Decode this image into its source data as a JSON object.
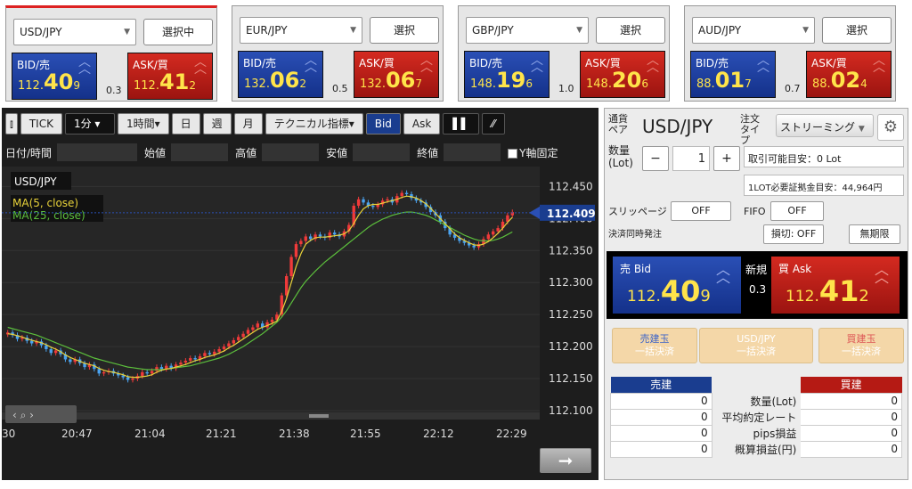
{
  "tiles": [
    {
      "pair": "USD/JPY",
      "button": "選択中",
      "bid_label": "BID/売",
      "ask_label": "ASK/買",
      "bid": {
        "sm": "112.",
        "big": "40",
        "pip": "9"
      },
      "ask": {
        "sm": "112.",
        "big": "41",
        "pip": "2"
      },
      "spread": "0.3"
    },
    {
      "pair": "EUR/JPY",
      "button": "選択",
      "bid_label": "BID/売",
      "ask_label": "ASK/買",
      "bid": {
        "sm": "132.",
        "big": "06",
        "pip": "2"
      },
      "ask": {
        "sm": "132.",
        "big": "06",
        "pip": "7"
      },
      "spread": "0.5"
    },
    {
      "pair": "GBP/JPY",
      "button": "選択",
      "bid_label": "BID/売",
      "ask_label": "ASK/買",
      "bid": {
        "sm": "148.",
        "big": "19",
        "pip": "6"
      },
      "ask": {
        "sm": "148.",
        "big": "20",
        "pip": "6"
      },
      "spread": "1.0"
    },
    {
      "pair": "AUD/JPY",
      "button": "選択",
      "bid_label": "BID/売",
      "ask_label": "ASK/買",
      "bid": {
        "sm": "88.",
        "big": "01",
        "pip": "7"
      },
      "ask": {
        "sm": "88.",
        "big": "02",
        "pip": "4"
      },
      "spread": "0.7"
    }
  ],
  "toolbar": {
    "tick": "TICK",
    "interval": "1分",
    "period": "1時間",
    "day": "日",
    "week": "週",
    "month": "月",
    "indicators": "テクニカル指標",
    "bid": "Bid",
    "ask": "Ask"
  },
  "fields": {
    "datetime": "日付/時間",
    "open": "始値",
    "high": "高値",
    "low": "安値",
    "close": "終値",
    "y_fixed": "Y軸固定"
  },
  "chart_data": {
    "type": "candlestick",
    "symbol": "USD/JPY",
    "legend": [
      "MA(5, close)",
      "MA(25, close)"
    ],
    "ylim": [
      112.1,
      112.47
    ],
    "yticks": [
      "112.450",
      "112.400",
      "112.350",
      "112.300",
      "112.250",
      "112.200",
      "112.150",
      "112.100"
    ],
    "xticks": [
      "30",
      "20:47",
      "21:04",
      "21:21",
      "21:38",
      "21:55",
      "22:12",
      "22:29"
    ],
    "current_price": "112.409",
    "close": [
      112.222,
      112.218,
      112.212,
      112.214,
      112.209,
      112.205,
      112.208,
      112.202,
      112.196,
      112.19,
      112.194,
      112.188,
      112.18,
      112.176,
      112.18,
      112.174,
      112.168,
      112.172,
      112.165,
      112.158,
      112.16,
      112.162,
      112.158,
      112.155,
      112.152,
      112.148,
      112.15,
      112.154,
      112.16,
      112.158,
      112.162,
      112.168,
      112.165,
      112.17,
      112.166,
      112.172,
      112.175,
      112.178,
      112.182,
      112.18,
      112.185,
      112.19,
      112.188,
      112.192,
      112.196,
      112.2,
      112.205,
      112.21,
      112.215,
      112.22,
      112.226,
      112.23,
      112.236,
      112.23,
      112.238,
      112.242,
      112.25,
      112.28,
      112.31,
      112.34,
      112.36,
      112.365,
      112.372,
      112.368,
      112.375,
      112.372,
      112.37,
      112.378,
      112.375,
      112.372,
      112.38,
      112.39,
      112.42,
      112.43,
      112.425,
      112.42,
      112.418,
      112.422,
      112.428,
      112.43,
      112.425,
      112.435,
      112.44,
      112.438,
      112.432,
      112.428,
      112.425,
      112.418,
      112.41,
      112.405,
      112.395,
      112.385,
      112.375,
      112.37,
      112.365,
      112.362,
      112.358,
      112.355,
      112.36,
      112.368,
      112.375,
      112.38,
      112.385,
      112.395,
      112.405,
      112.41
    ],
    "ma5": [
      112.22,
      112.219,
      112.217,
      112.215,
      112.212,
      112.21,
      112.208,
      112.206,
      112.203,
      112.199,
      112.196,
      112.192,
      112.187,
      112.183,
      112.18,
      112.177,
      112.174,
      112.172,
      112.17,
      112.166,
      112.163,
      112.161,
      112.16,
      112.158,
      112.156,
      112.153,
      112.152,
      112.152,
      112.153,
      112.154,
      112.156,
      112.16,
      112.163,
      112.165,
      112.166,
      112.168,
      112.17,
      112.172,
      112.175,
      112.178,
      112.18,
      112.183,
      112.185,
      112.187,
      112.19,
      112.193,
      112.198,
      112.202,
      112.207,
      112.212,
      112.217,
      112.222,
      112.227,
      112.23,
      112.233,
      112.236,
      112.24,
      112.255,
      112.275,
      112.3,
      112.325,
      112.345,
      112.36,
      112.366,
      112.37,
      112.371,
      112.371,
      112.372,
      112.373,
      112.374,
      112.376,
      112.381,
      112.392,
      112.405,
      112.415,
      112.42,
      112.422,
      112.422,
      112.424,
      112.426,
      112.428,
      112.43,
      112.433,
      112.435,
      112.434,
      112.432,
      112.428,
      112.423,
      112.416,
      112.408,
      112.4,
      112.392,
      112.384,
      112.376,
      112.37,
      112.366,
      112.362,
      112.359,
      112.358,
      112.36,
      112.364,
      112.37,
      112.377,
      112.385,
      112.394,
      112.402
    ],
    "ma25": [
      112.23,
      112.228,
      112.226,
      112.224,
      112.222,
      112.22,
      112.218,
      112.215,
      112.212,
      112.209,
      112.206,
      112.203,
      112.2,
      112.197,
      112.194,
      112.191,
      112.188,
      112.185,
      112.182,
      112.18,
      112.178,
      112.176,
      112.174,
      112.172,
      112.17,
      112.168,
      112.167,
      112.166,
      112.165,
      112.164,
      112.164,
      112.164,
      112.164,
      112.165,
      112.166,
      112.167,
      112.168,
      112.169,
      112.17,
      112.172,
      112.174,
      112.176,
      112.178,
      112.18,
      112.182,
      112.185,
      112.188,
      112.192,
      112.196,
      112.2,
      112.205,
      112.21,
      112.215,
      112.22,
      112.226,
      112.232,
      112.238,
      112.246,
      112.256,
      112.268,
      112.28,
      112.292,
      112.302,
      112.31,
      112.318,
      112.325,
      112.332,
      112.338,
      112.344,
      112.35,
      112.356,
      112.362,
      112.368,
      112.374,
      112.38,
      112.386,
      112.391,
      112.395,
      112.399,
      112.402,
      112.405,
      112.407,
      112.409,
      112.41,
      112.41,
      112.409,
      112.407,
      112.405,
      112.402,
      112.398,
      112.394,
      112.39,
      112.386,
      112.382,
      112.378,
      112.374,
      112.371,
      112.368,
      112.366,
      112.365,
      112.365,
      112.366,
      112.368,
      112.371,
      112.375,
      112.379
    ]
  },
  "order": {
    "pair_label": "通貨ペア",
    "pair": "USD/JPY",
    "type_label": "注文タイプ",
    "type_value": "ストリーミング",
    "qty_label": "数量(Lot)",
    "qty_minus": "−",
    "qty_value": "1",
    "qty_plus": "+",
    "tradable": "取引可能目安：0 Lot",
    "margin": "1LOT必要証拠金目安：44,964円",
    "slippage_label": "スリッページ",
    "slippage_value": "OFF",
    "fifo_label": "FIFO",
    "fifo_value": "OFF",
    "simul_label": "決済同時発注",
    "stop_value": "損切: OFF",
    "expiry_value": "無期限",
    "sell_label": "売 Bid",
    "buy_label": "買 Ask",
    "sell_price": {
      "sm": "112.",
      "big": "40",
      "pip": "9"
    },
    "buy_price": {
      "sm": "112.",
      "big": "41",
      "pip": "2"
    },
    "new_label": "新規",
    "spread": "0.3",
    "settle_sell_1": "売建玉",
    "settle_sell_2": "一括決済",
    "settle_pair_1": "USD/JPY",
    "settle_pair_2": "一括決済",
    "settle_buy_1": "買建玉",
    "settle_buy_2": "一括決済",
    "pos_sell_head": "売建",
    "pos_buy_head": "買建",
    "rows": [
      {
        "label": "数量(Lot)",
        "sell": "0",
        "buy": "0"
      },
      {
        "label": "平均約定レート",
        "sell": "0",
        "buy": "0"
      },
      {
        "label": "pips損益",
        "sell": "0",
        "buy": "0"
      },
      {
        "label": "概算損益(円)",
        "sell": "0",
        "buy": "0"
      }
    ]
  }
}
